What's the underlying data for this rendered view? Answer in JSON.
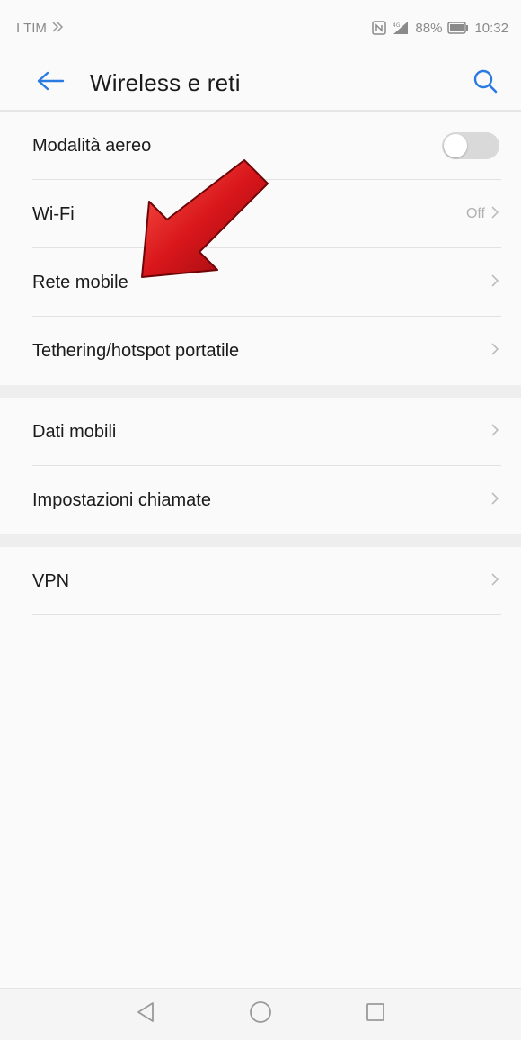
{
  "status_bar": {
    "carrier": "I TIM",
    "battery": "88%",
    "time": "10:32"
  },
  "header": {
    "title": "Wireless e reti",
    "back_icon": "arrow-left-icon",
    "search_icon": "search-icon"
  },
  "colors": {
    "accent": "#2a7ae2",
    "annotation_arrow": "#d8161b"
  },
  "sections": [
    {
      "items": [
        {
          "label": "Modalità aereo",
          "control": "toggle",
          "toggle_on": false
        },
        {
          "label": "Wi-Fi",
          "value": "Off",
          "control": "chevron"
        },
        {
          "label": "Rete mobile",
          "control": "chevron"
        },
        {
          "label": "Tethering/hotspot portatile",
          "control": "chevron"
        }
      ]
    },
    {
      "items": [
        {
          "label": "Dati mobili",
          "control": "chevron"
        },
        {
          "label": "Impostazioni chiamate",
          "control": "chevron"
        }
      ]
    },
    {
      "items": [
        {
          "label": "VPN",
          "control": "chevron"
        }
      ]
    }
  ],
  "nav_bar": {
    "icons": [
      "back-triangle-icon",
      "home-circle-icon",
      "recents-square-icon"
    ]
  }
}
